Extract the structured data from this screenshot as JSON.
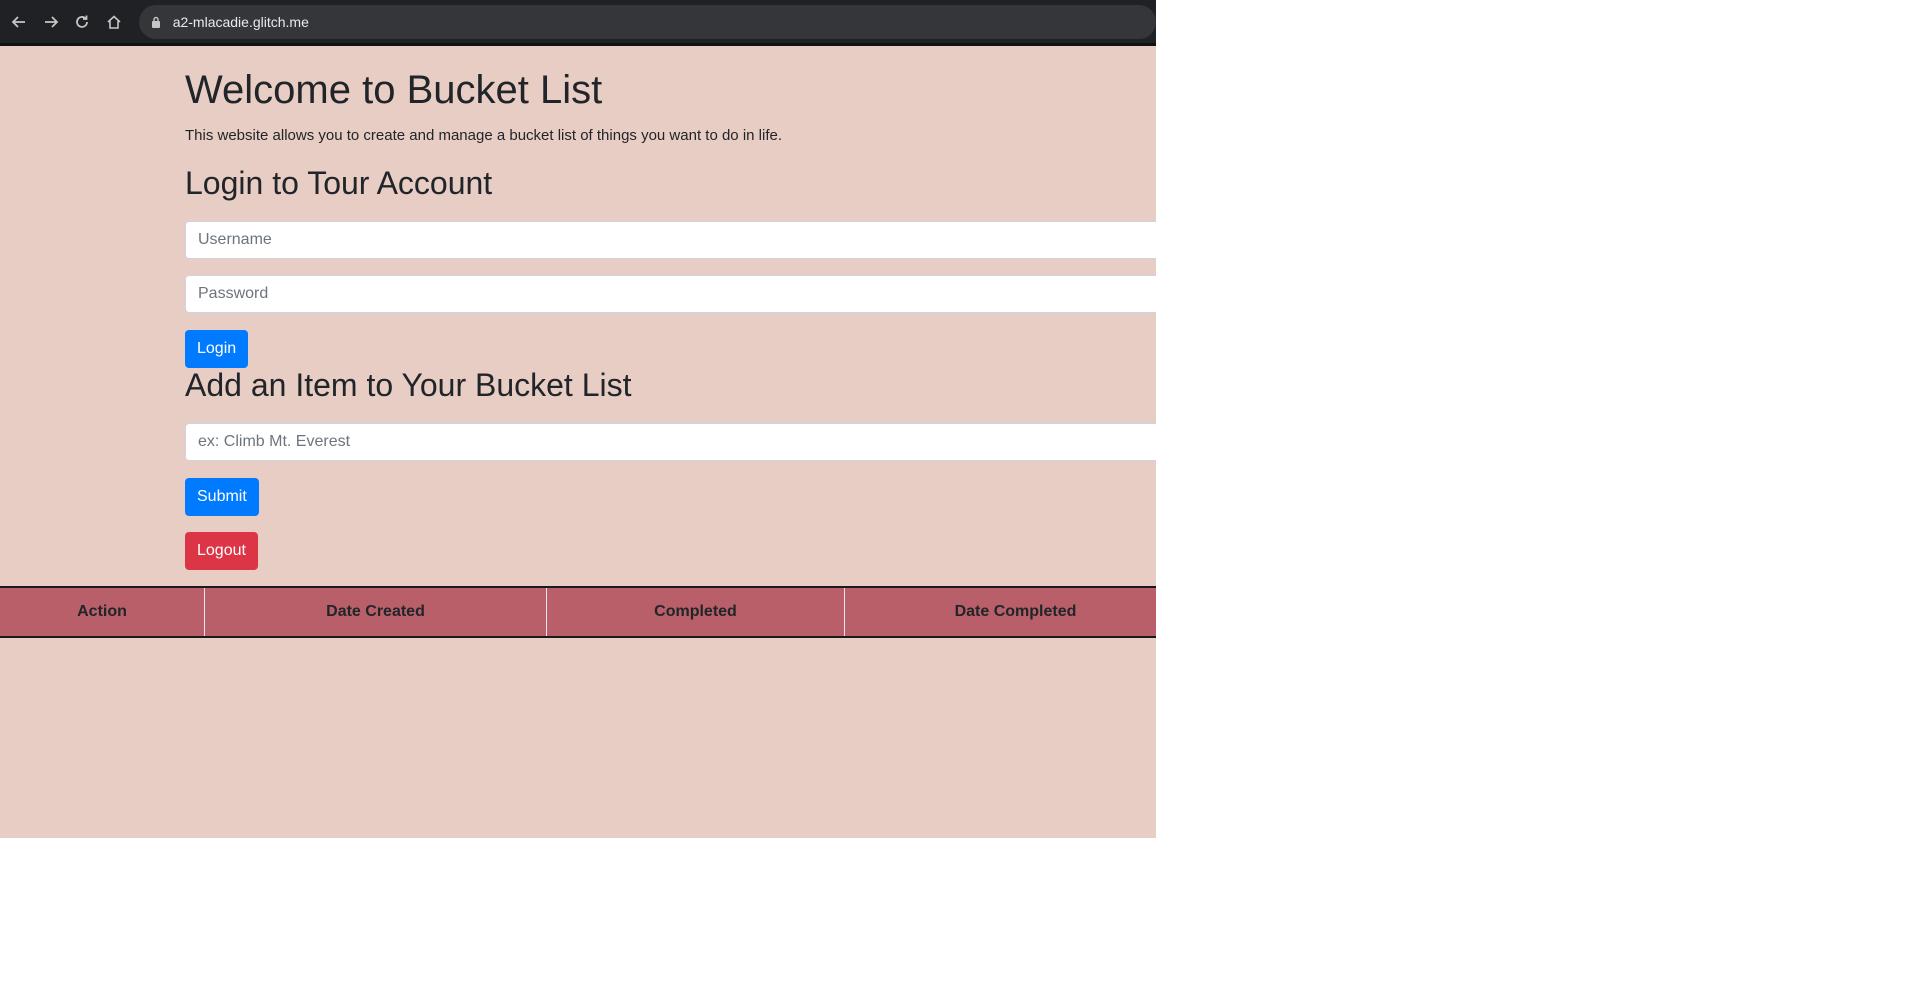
{
  "browser": {
    "url": "a2-mlacadie.glitch.me",
    "icons": [
      "back-arrow-icon",
      "forward-arrow-icon",
      "reload-icon",
      "home-icon",
      "lock-icon"
    ]
  },
  "page": {
    "title": "Welcome to Bucket List",
    "description": "This website allows you to create and manage a bucket list of things you want to do in life.",
    "login_heading": "Login to Tour Account",
    "username_placeholder": "Username",
    "password_placeholder": "Password",
    "login_label": "Login",
    "add_heading": "Add an Item to Your Bucket List",
    "item_placeholder": "ex: Climb Mt. Everest",
    "submit_label": "Submit",
    "logout_label": "Logout"
  },
  "table": {
    "headers": [
      "Action",
      "Date Created",
      "Completed",
      "Date Completed"
    ]
  },
  "colors": {
    "page_background": "#e8cdc4",
    "table_header": "#b85f69",
    "primary_button": "#007bff",
    "danger_button": "#dc3545"
  }
}
